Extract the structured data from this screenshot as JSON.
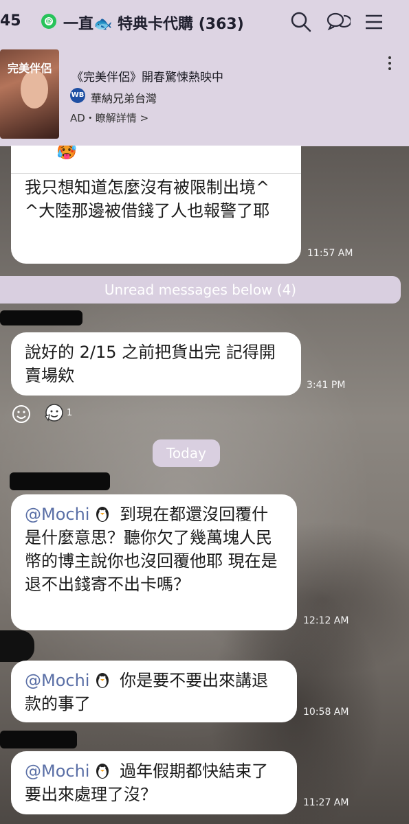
{
  "status_bar": {
    "time": "45"
  },
  "header": {
    "line_badge": "@",
    "title": "一直🐟 特典卡代購 (363)",
    "icons": [
      "search-icon",
      "chat-icon",
      "menu-icon"
    ]
  },
  "ad": {
    "poster_title": "完美伴侶",
    "title": "《完美伴侶》開春驚悚熱映中",
    "brand_logo": "WB",
    "brand": "華納兄弟台灣",
    "label": "AD・瞭解詳情 >"
  },
  "messages": {
    "m1": {
      "top_emoji": "🥵",
      "text": "我只想知道怎麼沒有被限制出境^ ^大陸那邊被借錢了人也報警了耶",
      "time": "11:57 AM"
    },
    "unread": "Unread messages below (4)",
    "m2": {
      "text": "說好的 2/15 之前把貨出完 記得開賣場欸",
      "time": "3:41 PM",
      "reaction_count": "1"
    },
    "date_divider": "Today",
    "m3": {
      "mention": "@Mochi",
      "text": " 到現在都還沒回覆什是什麼意思？聽你欠了幾萬塊人民幣的博主說你也沒回覆他耶 現在是退不出錢寄不出卡嗎？",
      "time": "12:12 AM"
    },
    "m4": {
      "mention": "@Mochi",
      "text": " 你是要不要出來講退款的事了",
      "time": "10:58 AM"
    },
    "m5": {
      "mention": "@Mochi",
      "text": " 過年假期都快結束了要出來處理了沒？",
      "time": "11:27 AM"
    }
  },
  "colors": {
    "header_bg": "#ddd4e3",
    "bubble_bg": "#ffffff",
    "mention": "#5a6fa6",
    "pill_bg": "#d9cfe0"
  }
}
